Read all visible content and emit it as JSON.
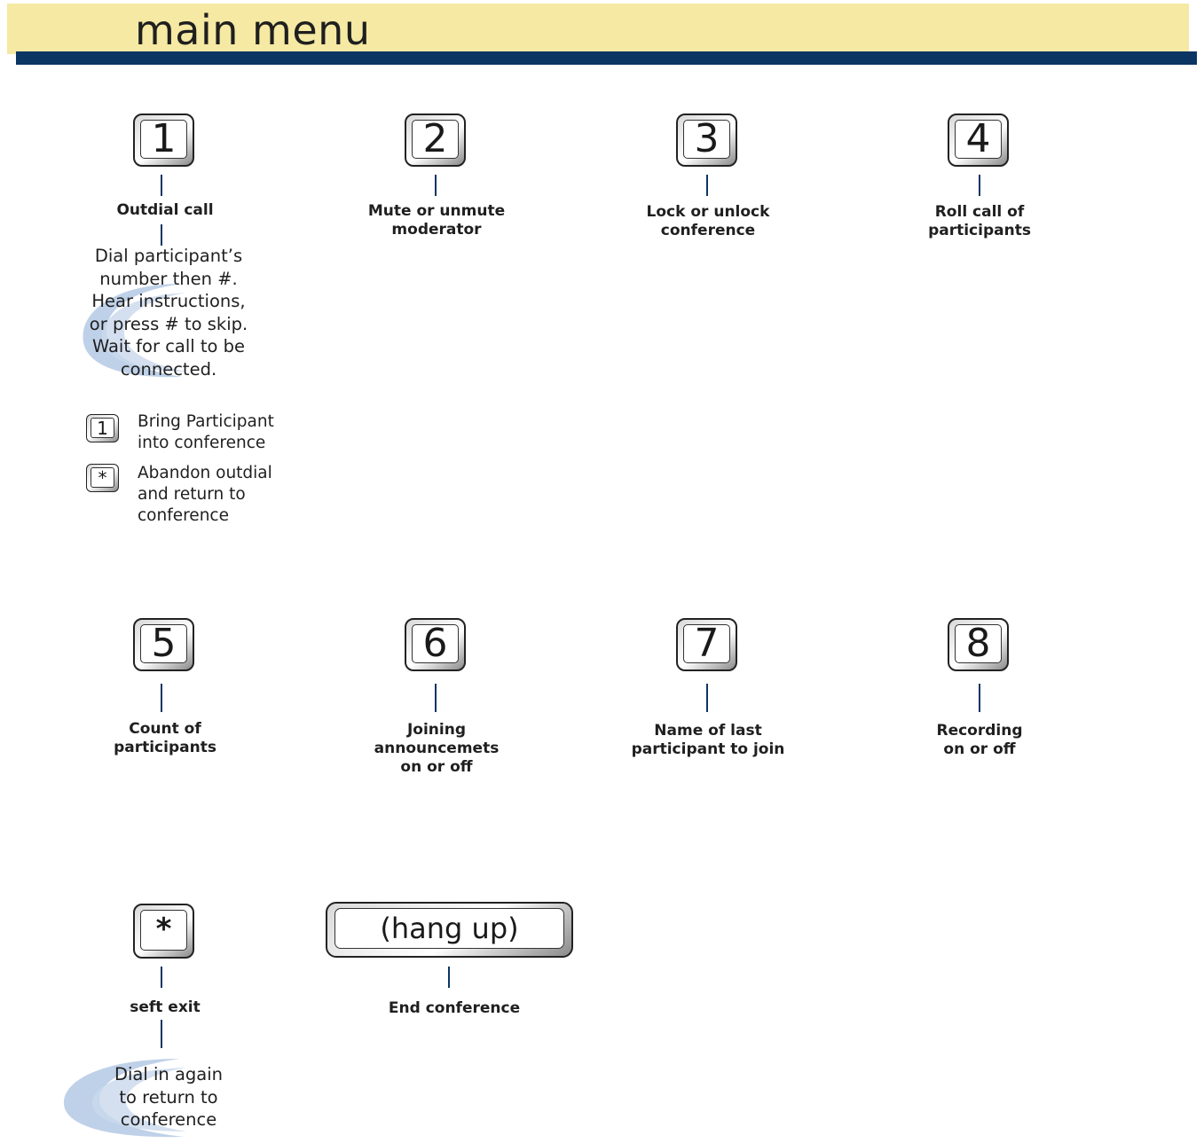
{
  "header": {
    "title": "main menu"
  },
  "keys": {
    "k1": "1",
    "k2": "2",
    "k3": "3",
    "k4": "4",
    "k5": "5",
    "k6": "6",
    "k7": "7",
    "k8": "8",
    "star": "*",
    "hang_up": "(hang up)"
  },
  "labels": {
    "k1": "Outdial call",
    "k2": "Mute or unmute\nmoderator",
    "k3": "Lock or unlock\nconference",
    "k4": "Roll call of\nparticipants",
    "k5": "Count of\nparticipants",
    "k6": "Joining\nannouncemets\non or off",
    "k7": "Name of last\nparticipant to join",
    "k8": "Recording\non or off",
    "star": "seft exit",
    "hang_up": "End conference"
  },
  "outdial": {
    "instructions": "Dial participant’s\nnumber then #.\nHear instructions,\nor press # to skip.\nWait for call to be\nconnected.",
    "options": [
      {
        "key": "1",
        "text": "Bring Participant\ninto conference"
      },
      {
        "key": "*",
        "text": "Abandon outdial\nand return to\nconference"
      }
    ]
  },
  "self_exit_note": "Dial in again\nto return to\nconference",
  "colors": {
    "header_band": "#f5e9a3",
    "header_rule": "#0b3563",
    "connector": "#0b3563",
    "swoosh": "#a9c1e0"
  }
}
